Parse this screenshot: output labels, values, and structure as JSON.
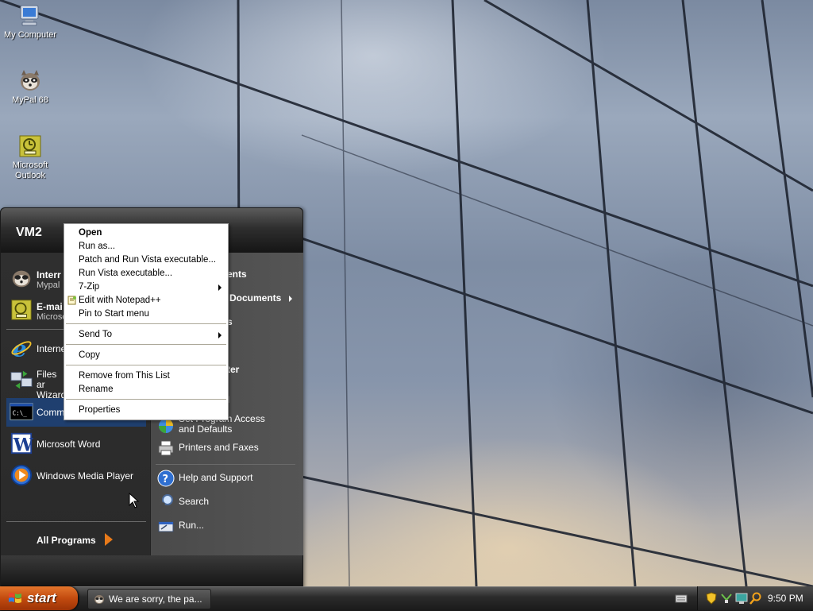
{
  "desktop": {
    "icons": [
      {
        "label": "My Computer",
        "icon": "my-computer-icon"
      },
      {
        "label": "MyPal 68",
        "icon": "mypal-raccoon-icon"
      },
      {
        "label": "Microsoft Outlook",
        "icon": "outlook-icon"
      }
    ]
  },
  "start_menu": {
    "user_name": "VM2",
    "pinned": [
      {
        "title": "Interr",
        "subtitle": "Mypal",
        "icon": "mypal-raccoon-icon"
      },
      {
        "title": "E-mai",
        "subtitle": "Microso",
        "icon": "outlook-icon"
      }
    ],
    "recent": [
      {
        "label": "Interne",
        "icon": "internet-explorer-icon"
      },
      {
        "label": "Files ar Wizard",
        "icon": "files-settings-transfer-icon"
      },
      {
        "label": "Comma",
        "icon": "command-prompt-icon",
        "highlighted": true
      },
      {
        "label": "Microsoft Word",
        "icon": "word-icon"
      },
      {
        "label": "Windows Media Player",
        "icon": "media-player-icon"
      }
    ],
    "all_programs_label": "All Programs",
    "right": [
      {
        "label": "ents",
        "bold": true
      },
      {
        "label": "Documents",
        "bold": true,
        "has_submenu": true
      },
      {
        "label": "s",
        "bold": true
      },
      {
        "label": "ter",
        "bold": true
      },
      {
        "label": "I",
        "bold": false
      },
      {
        "label": "Set Program Access and Defaults",
        "icon": "program-access-icon"
      },
      {
        "label": "Printers and Faxes",
        "icon": "printer-icon"
      },
      {
        "label": "Help and Support",
        "icon": "help-icon"
      },
      {
        "label": "Search",
        "icon": "search-icon"
      },
      {
        "label": "Run...",
        "icon": "run-icon"
      }
    ]
  },
  "context_menu": {
    "items": [
      {
        "label": "Open",
        "bold": true
      },
      {
        "label": "Run as..."
      },
      {
        "label": "Patch and Run Vista executable..."
      },
      {
        "label": "Run Vista executable..."
      },
      {
        "label": "7-Zip",
        "submenu": true
      },
      {
        "label": "Edit with Notepad++",
        "icon": "notepad-plus-plus-icon"
      },
      {
        "label": "Pin to Start menu"
      },
      {
        "label": "Send To",
        "submenu": true
      },
      {
        "label": "Copy"
      },
      {
        "label": "Remove from This List"
      },
      {
        "label": "Rename"
      },
      {
        "label": "Properties"
      }
    ]
  },
  "taskbar": {
    "start_label": "start",
    "task_button_label": "We are sorry, the pa...",
    "clock": "9:50 PM"
  }
}
